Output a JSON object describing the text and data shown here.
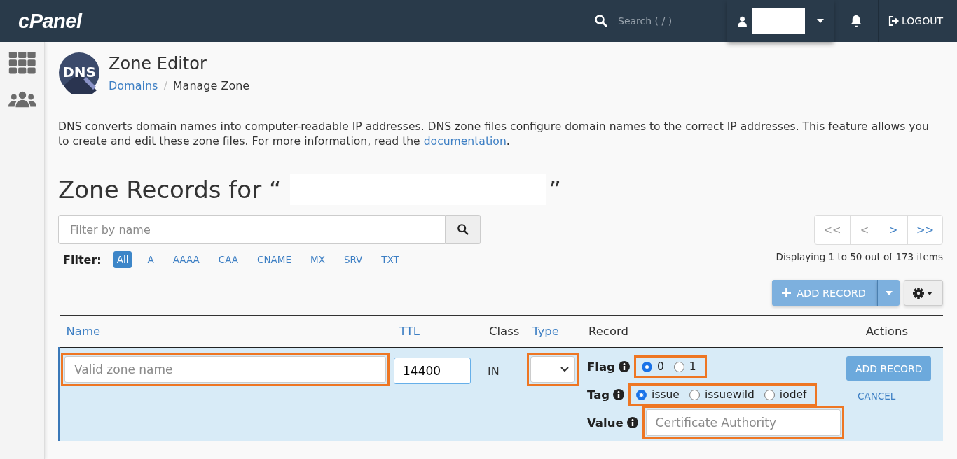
{
  "topbar": {
    "logo": "cPanel",
    "search": {
      "placeholder": "Search ( / )"
    },
    "logout": "LOGOUT"
  },
  "sidebar": {
    "items": [
      {
        "kind": "grid",
        "selected": false
      },
      {
        "kind": "users",
        "selected": false
      }
    ]
  },
  "header": {
    "logo_text": "DNS",
    "title": "Zone Editor",
    "separator": "/",
    "breadcrumb": [
      {
        "label": "Domains",
        "link": true
      },
      {
        "label": "Manage Zone",
        "link": false
      }
    ]
  },
  "intro": {
    "text": "DNS converts domain names into computer-readable IP addresses. DNS zone files configure domain names to the correct IP addresses. This feature allows you to create and edit these zone files. For more information, read the ",
    "link": "documentation",
    "after": "."
  },
  "zone_title": {
    "before": "Zone Records for “",
    "after": "”"
  },
  "filter_search": {
    "placeholder": "Filter by name"
  },
  "filter": {
    "label": "Filter:",
    "options": [
      {
        "label": "All",
        "selected": true
      },
      {
        "label": "A",
        "selected": false
      },
      {
        "label": "AAAA",
        "selected": false
      },
      {
        "label": "CAA",
        "selected": false
      },
      {
        "label": "CNAME",
        "selected": false
      },
      {
        "label": "MX",
        "selected": false
      },
      {
        "label": "SRV",
        "selected": false
      },
      {
        "label": "TXT",
        "selected": false
      }
    ]
  },
  "pagination": {
    "buttons": [
      {
        "label": "<<",
        "disabled": true
      },
      {
        "label": "<",
        "disabled": true
      },
      {
        "label": ">",
        "disabled": false
      },
      {
        "label": ">>",
        "disabled": false
      }
    ],
    "summary": "Displaying 1 to 50 out of 173 items"
  },
  "add_record_button": "ADD RECORD",
  "table": {
    "columns": [
      {
        "label": "Name",
        "sortable": true
      },
      {
        "label": "TTL",
        "sortable": true
      },
      {
        "label": "Class",
        "sortable": false
      },
      {
        "label": "Type",
        "sortable": true
      },
      {
        "label": "Record",
        "sortable": false
      },
      {
        "label": "Actions",
        "sortable": false
      }
    ],
    "edit_row": {
      "name": {
        "placeholder": "Valid zone name",
        "highlighted": true
      },
      "ttl": {
        "value": "14400"
      },
      "class": "IN",
      "type": {
        "highlighted": true
      },
      "fields": [
        {
          "kind": "radio",
          "label": "Flag",
          "highlighted": true,
          "options": [
            {
              "label": "0",
              "selected": true
            },
            {
              "label": "1",
              "selected": false
            }
          ]
        },
        {
          "kind": "radio",
          "label": "Tag",
          "highlighted": true,
          "options": [
            {
              "label": "issue",
              "selected": true
            },
            {
              "label": "issuewild",
              "selected": false
            },
            {
              "label": "iodef",
              "selected": false
            }
          ]
        },
        {
          "kind": "text",
          "label": "Value",
          "highlighted": true,
          "placeholder": "Certificate Authority"
        }
      ],
      "add_button": "ADD RECORD",
      "cancel": "CANCEL"
    }
  }
}
